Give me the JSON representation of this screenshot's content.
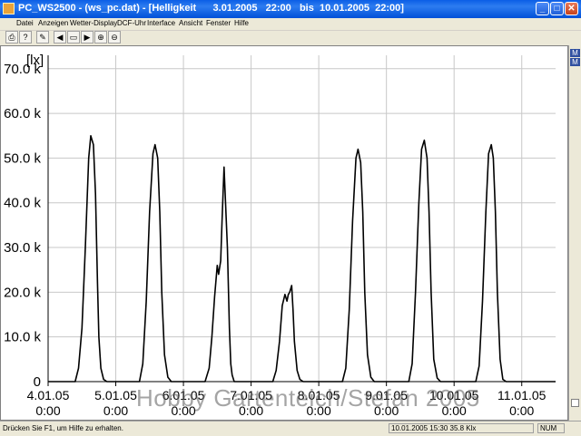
{
  "window": {
    "title": "PC_WS2500 - (ws_pc.dat) - [Helligkeit      3.01.2005   22:00   bis  10.01.2005  22:00]",
    "min_label": "_",
    "max_label": "□",
    "close_label": "✕"
  },
  "menu": {
    "items": [
      "Datei",
      "Anzeigen",
      "Wetter-Display",
      "DCF-Uhr",
      "Interface",
      "Ansicht",
      "Fenster",
      "Hilfe"
    ]
  },
  "toolbar": {
    "buttons": [
      {
        "name": "print-icon",
        "glyph": "⎙"
      },
      {
        "name": "help-icon",
        "glyph": "?"
      },
      {
        "name": "pen-icon",
        "glyph": "✎"
      },
      {
        "name": "arrow-left-icon",
        "glyph": "◀"
      },
      {
        "name": "fit-icon",
        "glyph": "▭"
      },
      {
        "name": "arrow-right-icon",
        "glyph": "▶"
      },
      {
        "name": "zoom-in-icon",
        "glyph": "⊕"
      },
      {
        "name": "zoom-out-icon",
        "glyph": "⊖"
      }
    ]
  },
  "chart_data": {
    "type": "line",
    "title": "",
    "ylabel": "[lx]",
    "xlabel": "",
    "ylim": [
      0,
      73000
    ],
    "xlim": [
      0,
      7.5
    ],
    "grid": true,
    "y_ticks": [
      {
        "value": 0,
        "label": "0"
      },
      {
        "value": 10000,
        "label": "10.0 k"
      },
      {
        "value": 20000,
        "label": "20.0 k"
      },
      {
        "value": 30000,
        "label": "30.0 k"
      },
      {
        "value": 40000,
        "label": "40.0 k"
      },
      {
        "value": 50000,
        "label": "50.0 k"
      },
      {
        "value": 60000,
        "label": "60.0 k"
      },
      {
        "value": 70000,
        "label": "70.0 k"
      }
    ],
    "x_ticks": [
      {
        "value": 0,
        "date": "4.01.05",
        "time": "0:00"
      },
      {
        "value": 1,
        "date": "5.01.05",
        "time": "0:00"
      },
      {
        "value": 2,
        "date": "6.01.05",
        "time": "0:00"
      },
      {
        "value": 3,
        "date": "7.01.05",
        "time": "0:00"
      },
      {
        "value": 4,
        "date": "8.01.05",
        "time": "0:00"
      },
      {
        "value": 5,
        "date": "9.01.05",
        "time": "0:00"
      },
      {
        "value": 6,
        "date": "10.01.05",
        "time": "0:00"
      },
      {
        "value": 7,
        "date": "11.01.05",
        "time": "0:00"
      }
    ],
    "series": [
      {
        "x": [
          0,
          0.4,
          0.45,
          0.5,
          0.55,
          0.6,
          0.63,
          0.67,
          0.7,
          0.73,
          0.75,
          0.78,
          0.82,
          0.87,
          0.92,
          1.35,
          1.4,
          1.45,
          1.5,
          1.55,
          1.58,
          1.62,
          1.65,
          1.68,
          1.72,
          1.77,
          1.82,
          1.87,
          2.32,
          2.38,
          2.42,
          2.46,
          2.5,
          2.52,
          2.55,
          2.57,
          2.6,
          2.65,
          2.68,
          2.7,
          2.72,
          2.75,
          2.8,
          2.85,
          3.32,
          3.37,
          3.42,
          3.46,
          3.5,
          3.53,
          3.55,
          3.57,
          3.6,
          3.62,
          3.64,
          3.68,
          3.72,
          3.77,
          3.82,
          4.35,
          4.4,
          4.45,
          4.5,
          4.55,
          4.58,
          4.62,
          4.65,
          4.68,
          4.72,
          4.77,
          4.82,
          4.87,
          5.33,
          5.38,
          5.43,
          5.48,
          5.52,
          5.56,
          5.6,
          5.63,
          5.66,
          5.7,
          5.75,
          5.8,
          5.85,
          6.32,
          6.37,
          6.42,
          6.47,
          6.51,
          6.55,
          6.58,
          6.61,
          6.64,
          6.68,
          6.72,
          6.77,
          6.82,
          7.5
        ],
        "y": [
          0,
          0,
          3000,
          12000,
          30000,
          50000,
          55000,
          53000,
          42000,
          22000,
          10000,
          3000,
          500,
          0,
          0,
          0,
          4000,
          18000,
          38000,
          51000,
          53000,
          50000,
          38000,
          20000,
          6000,
          1000,
          0,
          0,
          0,
          3000,
          10000,
          19000,
          26000,
          24000,
          27000,
          36000,
          48000,
          30000,
          12000,
          4000,
          1500,
          0,
          0,
          0,
          0,
          2500,
          9000,
          17000,
          19500,
          18000,
          19500,
          20000,
          21500,
          16000,
          9000,
          2500,
          500,
          0,
          0,
          0,
          3000,
          16000,
          36000,
          50000,
          52000,
          49000,
          38000,
          20000,
          6000,
          1000,
          0,
          0,
          0,
          4000,
          20000,
          40000,
          52000,
          54000,
          50000,
          38000,
          20000,
          5000,
          800,
          0,
          0,
          0,
          3500,
          18000,
          38000,
          51000,
          53000,
          50000,
          38000,
          20000,
          5000,
          500,
          0,
          0,
          0
        ]
      }
    ]
  },
  "watermark": "Hobby Gartenteich/Stefan 2005",
  "status": {
    "hint": "Drücken Sie F1, um Hilfe zu erhalten.",
    "readout": "10.01.2005  15:30  35.8 Klx",
    "num": "NUM"
  },
  "side_strip": {
    "labels": [
      "M",
      "M"
    ]
  }
}
